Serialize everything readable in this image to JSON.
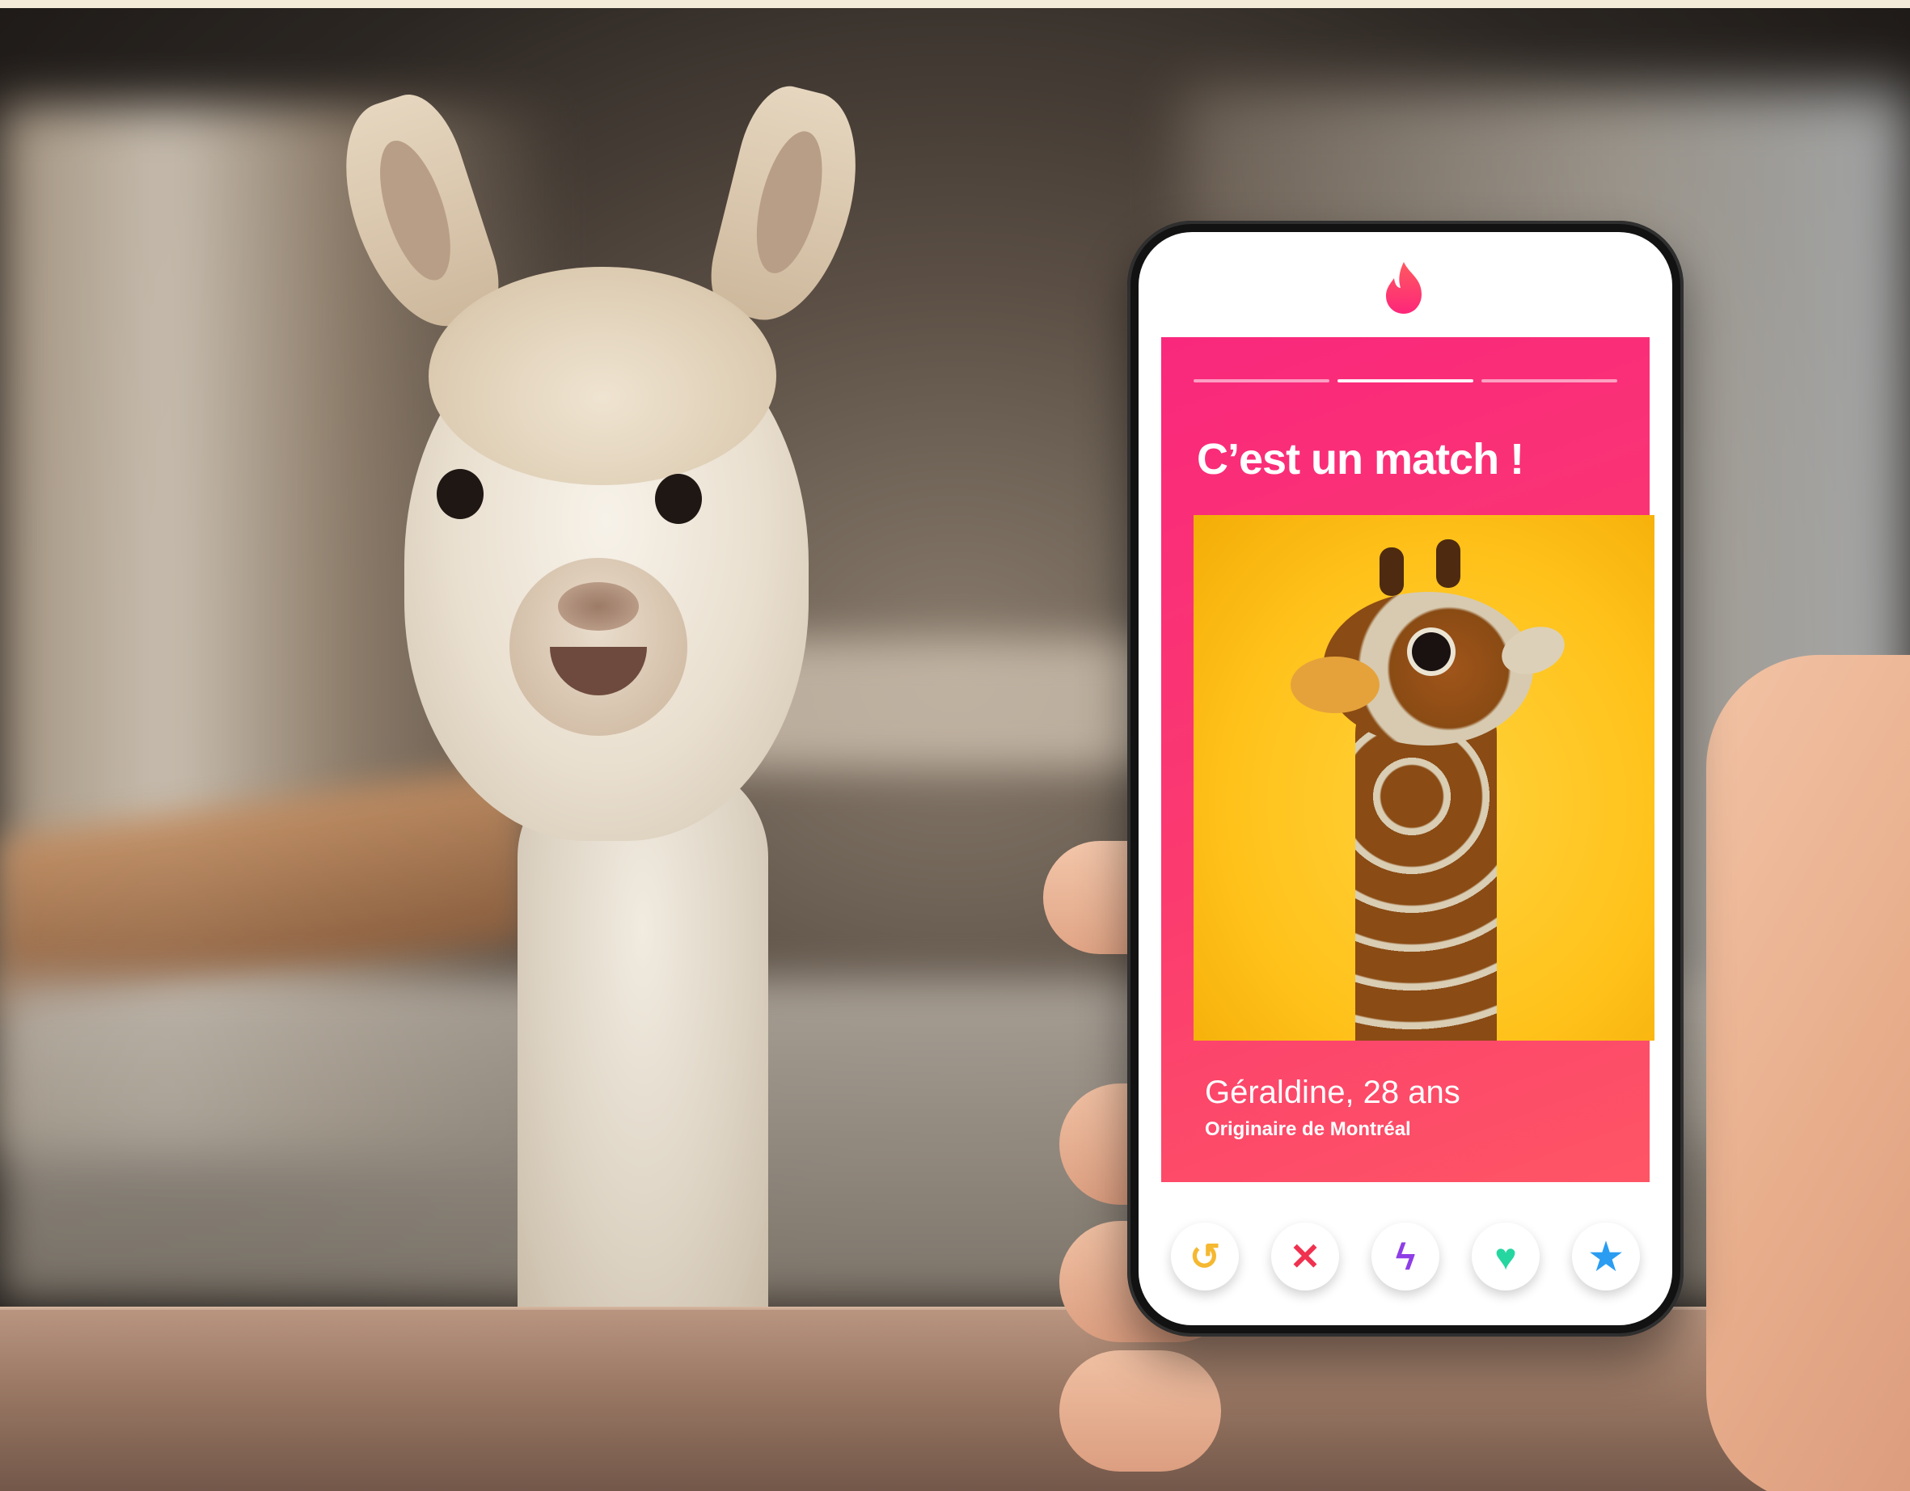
{
  "card": {
    "title": "C’est un match !",
    "name": "Géraldine, 28 ans",
    "origin": "Originaire de Montréal",
    "progress": {
      "segments": 3,
      "active": 2
    }
  },
  "actions": [
    {
      "name": "rewind-button",
      "icon": "rewind-icon",
      "glyph": "↺",
      "color": "#f5b831"
    },
    {
      "name": "nope-button",
      "icon": "close-icon",
      "glyph": "✕",
      "color": "#f0314f"
    },
    {
      "name": "boost-button",
      "icon": "lightning-icon",
      "glyph": "ϟ",
      "color": "#8e3ee6"
    },
    {
      "name": "like-button",
      "icon": "heart-icon",
      "glyph": "♥",
      "color": "#25d6a0"
    },
    {
      "name": "super-like-button",
      "icon": "star-icon",
      "glyph": "★",
      "color": "#2a9df2"
    }
  ],
  "colors": {
    "brand": "#fd2e6e",
    "photo_background": "#ffc21b"
  },
  "icons": {
    "brand_logo": "flame-logo-icon"
  }
}
